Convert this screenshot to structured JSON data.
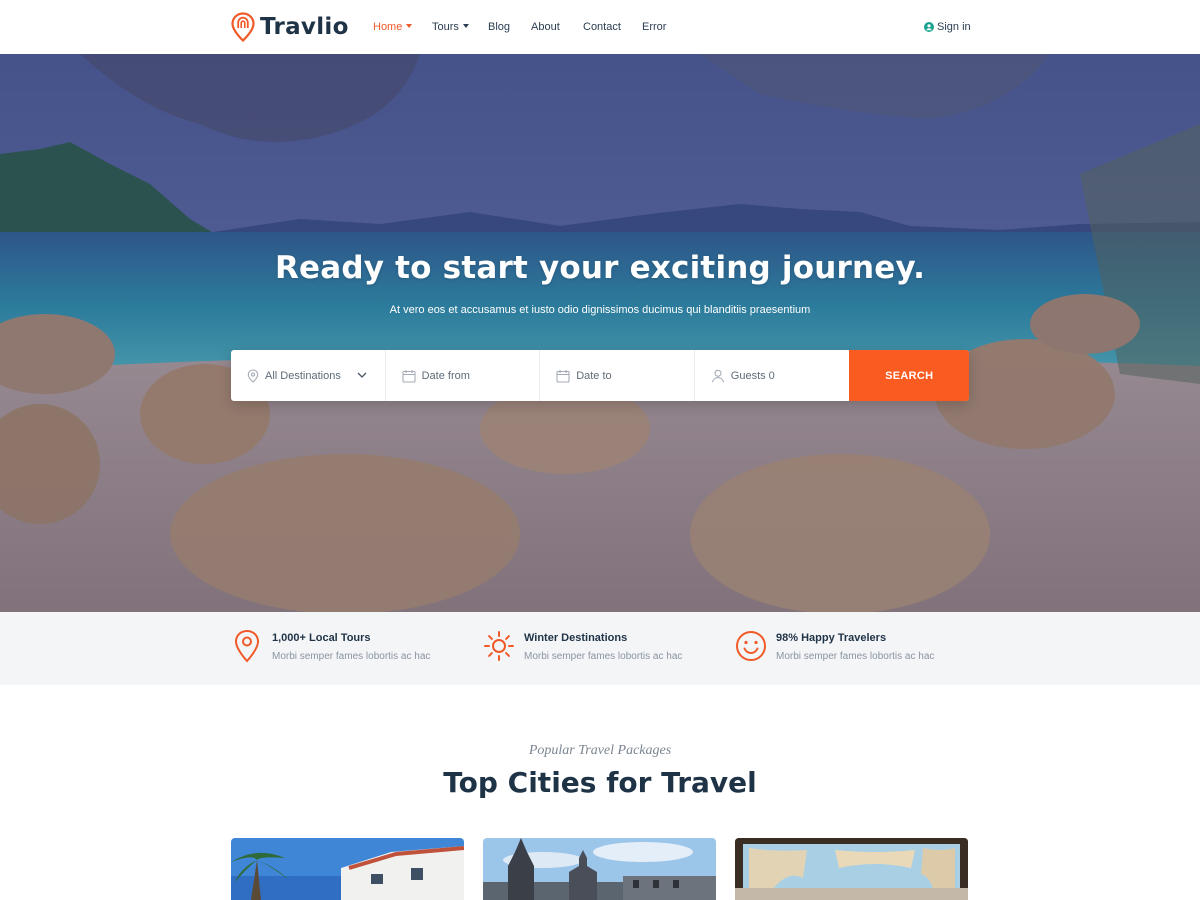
{
  "brand": {
    "name": "Travlio",
    "accent": "#fa5b21",
    "dark": "#1f3347"
  },
  "nav": {
    "items": [
      {
        "label": "Home",
        "dropdown": true,
        "active": true
      },
      {
        "label": "Tours",
        "dropdown": true,
        "active": false
      },
      {
        "label": "Blog",
        "dropdown": false,
        "active": false
      },
      {
        "label": "About",
        "dropdown": false,
        "active": false
      },
      {
        "label": "Contact",
        "dropdown": false,
        "active": false
      },
      {
        "label": "Error",
        "dropdown": false,
        "active": false
      }
    ],
    "signin": {
      "label": "Sign in",
      "icon": "user-circle-icon"
    }
  },
  "hero": {
    "title": "Ready to start your exciting journey.",
    "subtitle": "At vero eos et accusamus et iusto odio dignissimos ducimus qui blanditiis praesentium"
  },
  "search": {
    "destination": {
      "value": "All Destinations",
      "icon": "map-pin-icon"
    },
    "date_from": {
      "placeholder": "Date from",
      "icon": "calendar-icon"
    },
    "date_to": {
      "placeholder": "Date to",
      "icon": "calendar-icon"
    },
    "guests": {
      "value": "Guests 0",
      "icon": "user-icon"
    },
    "button_label": "SEARCH"
  },
  "features": [
    {
      "title": "1,000+ Local Tours",
      "desc": "Morbi semper fames lobortis ac hac",
      "icon": "map-pin-icon"
    },
    {
      "title": "Winter Destinations",
      "desc": "Morbi semper fames lobortis ac hac",
      "icon": "sun-icon"
    },
    {
      "title": "98% Happy Travelers",
      "desc": "Morbi semper fames lobortis ac hac",
      "icon": "smile-icon"
    }
  ],
  "section": {
    "kicker": "Popular Travel Packages",
    "title": "Top Cities for Travel"
  }
}
